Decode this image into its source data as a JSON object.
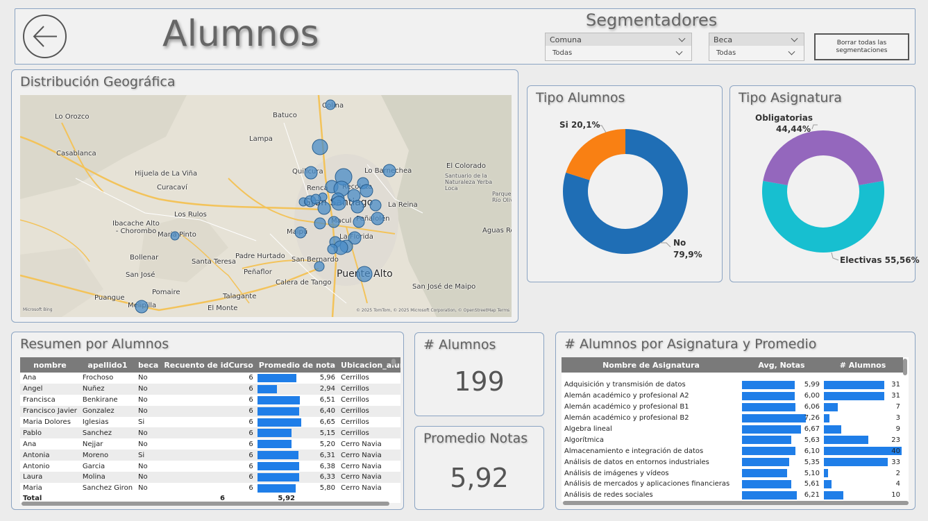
{
  "header": {
    "title": "Alumnos",
    "segmentadores_title": "Segmentadores",
    "slicers": [
      {
        "label": "Comuna",
        "value": "Todas"
      },
      {
        "label": "Beca",
        "value": "Todas"
      }
    ],
    "clear_button": "Borrar todas las segmentaciones"
  },
  "map": {
    "title": "Distribución Geográfica",
    "attribution": "© 2025 TomTom, © 2025 Microsoft Corporation, © OpenStreetMap  Terms",
    "provider": "Microsoft Bing",
    "labels": [
      {
        "text": "Colina",
        "cls": ""
      },
      {
        "text": "Lo Orozco",
        "cls": ""
      },
      {
        "text": "Batuco",
        "cls": ""
      },
      {
        "text": "Lampa",
        "cls": ""
      },
      {
        "text": "Casablanca",
        "cls": ""
      },
      {
        "text": "Hijuela de La Viña",
        "cls": ""
      },
      {
        "text": "Quilicura",
        "cls": ""
      },
      {
        "text": "Lo Barnechea",
        "cls": ""
      },
      {
        "text": "El Colorado",
        "cls": ""
      },
      {
        "text": "Curacaví",
        "cls": ""
      },
      {
        "text": "Renca",
        "cls": ""
      },
      {
        "text": "Recoleta",
        "cls": ""
      },
      {
        "text": "Gran Santiago",
        "cls": "big"
      },
      {
        "text": "La Reina",
        "cls": ""
      },
      {
        "text": "Los Rulos",
        "cls": ""
      },
      {
        "text": "Ibacache Alto - Chorombo",
        "cls": ""
      },
      {
        "text": "Maria Pinto",
        "cls": ""
      },
      {
        "text": "Macul",
        "cls": ""
      },
      {
        "text": "Peñalolén",
        "cls": ""
      },
      {
        "text": "Maipú",
        "cls": ""
      },
      {
        "text": "La Florida",
        "cls": ""
      },
      {
        "text": "Aguas Rea",
        "cls": ""
      },
      {
        "text": "Bollenar",
        "cls": ""
      },
      {
        "text": "Santa Teresa",
        "cls": ""
      },
      {
        "text": "Padre Hurtado",
        "cls": ""
      },
      {
        "text": "San Bernardo",
        "cls": ""
      },
      {
        "text": "San José",
        "cls": ""
      },
      {
        "text": "Peñaflor",
        "cls": ""
      },
      {
        "text": "Puente Alto",
        "cls": "big"
      },
      {
        "text": "Calera de Tango",
        "cls": ""
      },
      {
        "text": "Pomaire",
        "cls": ""
      },
      {
        "text": "San José de Maipo",
        "cls": ""
      },
      {
        "text": "Puangue",
        "cls": ""
      },
      {
        "text": "Talagante",
        "cls": ""
      },
      {
        "text": "Melipilla",
        "cls": ""
      },
      {
        "text": "El Monte",
        "cls": ""
      },
      {
        "text": "Santuario de la Naturaleza Yerba Loca",
        "cls": "small"
      },
      {
        "text": "Parque Nacional Río Olivares",
        "cls": "small"
      }
    ]
  },
  "tipo_alumnos": {
    "title": "Tipo Alumnos",
    "slices": [
      {
        "name": "No",
        "pct_label": "79,9%",
        "value": 79.9,
        "color": "#1f6eb5"
      },
      {
        "name": "Si",
        "pct_label": "20,1%",
        "value": 20.1,
        "color": "#f98013"
      }
    ]
  },
  "tipo_asignatura": {
    "title": "Tipo Asignatura",
    "slices": [
      {
        "name": "Electivas",
        "pct_label": "55,56%",
        "value": 55.56,
        "color": "#17bfd0"
      },
      {
        "name": "Obligatorias",
        "pct_label": "44,44%",
        "value": 44.44,
        "color": "#9467bd"
      }
    ]
  },
  "resumen": {
    "title": "Resumen por Alumnos",
    "columns": [
      "nombre",
      "apellido1",
      "beca",
      "Recuento de idCurso",
      "Promedio de nota",
      "Ubicacion_alum.Comuna"
    ],
    "rows": [
      [
        "Ana",
        "Frochoso",
        "No",
        "6",
        "5,96",
        "Cerrillos"
      ],
      [
        "Angel",
        "Nuñez",
        "No",
        "6",
        "2,94",
        "Cerrillos"
      ],
      [
        "Francisca",
        "Benkirane",
        "No",
        "6",
        "6,51",
        "Cerrillos"
      ],
      [
        "Francisco Javier",
        "Gonzalez",
        "No",
        "6",
        "6,40",
        "Cerrillos"
      ],
      [
        "Maria Dolores",
        "Iglesias",
        "Si",
        "6",
        "6,65",
        "Cerrillos"
      ],
      [
        "Pablo",
        "Sanchez",
        "No",
        "6",
        "5,15",
        "Cerrillos"
      ],
      [
        "Ana",
        "Nejjar",
        "No",
        "6",
        "5,20",
        "Cerro Navia"
      ],
      [
        "Antonia",
        "Moreno",
        "Si",
        "6",
        "6,31",
        "Cerro Navia"
      ],
      [
        "Antonio",
        "Garcia",
        "No",
        "6",
        "6,38",
        "Cerro Navia"
      ],
      [
        "Laura",
        "Molina",
        "No",
        "6",
        "6,33",
        "Cerro Navia"
      ],
      [
        "Maria",
        "Sanchez Giron",
        "No",
        "6",
        "5,80",
        "Cerro Navia"
      ]
    ],
    "nota_values": [
      5.96,
      2.94,
      6.51,
      6.4,
      6.65,
      5.15,
      5.2,
      6.31,
      6.38,
      6.33,
      5.8
    ],
    "total": {
      "label": "Total",
      "recuento": "6",
      "promedio": "5,92"
    }
  },
  "kpi_alumnos": {
    "title": "# Alumnos",
    "value": "199"
  },
  "kpi_notas": {
    "title": "Promedio Notas",
    "value": "5,92"
  },
  "asignaturas": {
    "title": "# Alumnos por Asignatura y Promedio",
    "columns": [
      "Nombre de Asignatura",
      "Avg, Notas",
      "# Alumnos"
    ],
    "rows": [
      {
        "name": "Adquisición y transmisión de datos",
        "avg": "5,99",
        "avg_v": 5.99,
        "alumnos": "31",
        "al_v": 31
      },
      {
        "name": "Alemán académico y profesional A2",
        "avg": "6,00",
        "avg_v": 6.0,
        "alumnos": "31",
        "al_v": 31
      },
      {
        "name": "Alemán académico y profesional B1",
        "avg": "6,06",
        "avg_v": 6.06,
        "alumnos": "7",
        "al_v": 7
      },
      {
        "name": "Alemán académico y profesional B2",
        "avg": "7,26",
        "avg_v": 7.26,
        "alumnos": "3",
        "al_v": 3
      },
      {
        "name": "Algebra lineal",
        "avg": "6,67",
        "avg_v": 6.67,
        "alumnos": "9",
        "al_v": 9
      },
      {
        "name": "Algorítmica",
        "avg": "5,63",
        "avg_v": 5.63,
        "alumnos": "23",
        "al_v": 23
      },
      {
        "name": "Almacenamiento e integración de datos",
        "avg": "6,10",
        "avg_v": 6.1,
        "alumnos": "40",
        "al_v": 40
      },
      {
        "name": "Análisis de datos en entornos industriales",
        "avg": "5,35",
        "avg_v": 5.35,
        "alumnos": "33",
        "al_v": 33
      },
      {
        "name": "Análisis de imágenes y vídeos",
        "avg": "5,10",
        "avg_v": 5.1,
        "alumnos": "2",
        "al_v": 2
      },
      {
        "name": "Análisis de mercados y aplicaciones financieras",
        "avg": "5,61",
        "avg_v": 5.61,
        "alumnos": "4",
        "al_v": 4
      },
      {
        "name": "Análisis de redes sociales",
        "avg": "6,21",
        "avg_v": 6.21,
        "alumnos": "10",
        "al_v": 10
      }
    ]
  }
}
